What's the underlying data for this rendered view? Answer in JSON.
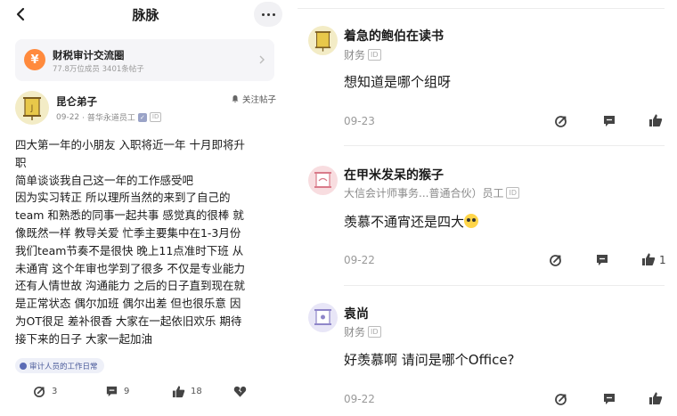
{
  "header": {
    "title": "脉脉"
  },
  "circle": {
    "name": "财税审计交流圈",
    "stats": "77.8万位成员 3401条帖子",
    "icon": "yen-icon"
  },
  "post": {
    "author": "昆仑弟子",
    "date": "09-22",
    "company": "· 普华永道员工",
    "id_badge": "ID",
    "follow_label": "关注帖子",
    "lines": [
      "四大第一年的小朋友 入职将近一年 十月即将升",
      "职",
      "简单谈谈我自己这一年的工作感受吧",
      "因为实习转正 所以理所当然的来到了自己的",
      "team 和熟悉的同事一起共事 感觉真的很棒 就",
      "像既然一样 教导关爱 忙季主要集中在1-3月份",
      "我们team节奏不是很快 晚上11点准时下班 从",
      "未通宵 这个年审也学到了很多 不仅是专业能力",
      "还有人情世故 沟通能力 之后的日子直到现在就",
      "是正常状态 偶尔加班 偶尔出差 但也很乐意 因",
      "为OT很足 差补很香 大家在一起依旧欢乐 期待",
      "接下来的日子 大家一起加油"
    ],
    "tag": "审计人员的工作日常",
    "actions": {
      "share_count": "3",
      "comment_count": "9",
      "like_count": "18"
    }
  },
  "comments": [
    {
      "name": "着急的鲍伯在读书",
      "meta": "财务",
      "id_badge": "ID",
      "text": "想知道是哪个组呀",
      "date": "09-23",
      "like_count": ""
    },
    {
      "name": "在甲米发呆的猴子",
      "meta": "大信会计师事务...普通合伙）员工",
      "id_badge": "ID",
      "text": "羡慕不通宵还是四大",
      "date": "09-22",
      "like_count": "1"
    },
    {
      "name": "袁尚",
      "meta": "财务",
      "id_badge": "ID",
      "text": "好羡慕啊 请问是哪个Office?",
      "date": "09-22",
      "like_count": ""
    }
  ],
  "colors": {
    "accent": "#4a5a9a",
    "circle_icon": "#ff8a3d",
    "badge": "#9aa3c7"
  }
}
